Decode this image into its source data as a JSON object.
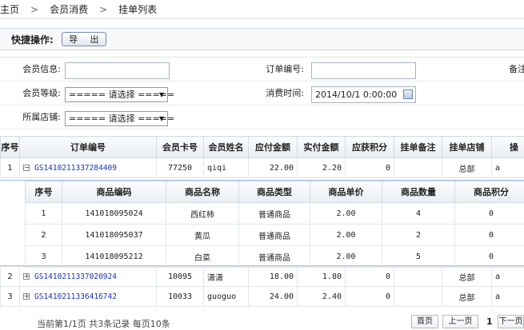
{
  "breadcrumb": {
    "items": [
      "主页",
      "会员消费",
      "挂单列表"
    ],
    "sep": ">"
  },
  "quick": {
    "label": "快捷操作:",
    "export_button": "导 出"
  },
  "form": {
    "member_info_label": "会员信息:",
    "member_info_value": "",
    "order_no_label": "订单编号:",
    "order_no_value": "",
    "remark_label": "备注",
    "member_level_label": "会员等级:",
    "member_level_value": "===== 请选择 =====",
    "consume_time_label": "消费时间:",
    "consume_time_value": "2014/10/1 0:00:00",
    "store_label": "所属店铺:",
    "store_value": "===== 请选择 ====="
  },
  "table": {
    "headers": [
      "序号",
      "订单编号",
      "会员卡号",
      "会员姓名",
      "应付金额",
      "实付金额",
      "应获积分",
      "挂单备注",
      "挂单店铺",
      "操"
    ],
    "rows": [
      {
        "no": "1",
        "order": "GS1410211337284409",
        "card": "77250",
        "name": "qiqi",
        "due": "22.00",
        "paid": "2.20",
        "points": "0",
        "remark": "",
        "store": "总部",
        "op": "a",
        "expander": "−"
      },
      {
        "no": "2",
        "order": "GS1410211337020924",
        "card": "10095",
        "name": "潇潇",
        "due": "18.00",
        "paid": "1.80",
        "points": "0",
        "remark": "",
        "store": "总部",
        "op": "a",
        "expander": "+"
      },
      {
        "no": "3",
        "order": "GS1410211336416742",
        "card": "10033",
        "name": "guoguo",
        "due": "24.00",
        "paid": "2.40",
        "points": "0",
        "remark": "",
        "store": "总部",
        "op": "a",
        "expander": "+"
      }
    ]
  },
  "detail": {
    "headers": [
      "序号",
      "商品编码",
      "商品名称",
      "商品类型",
      "商品单价",
      "商品数量",
      "商品积分"
    ],
    "rows": [
      {
        "no": "1",
        "code": "141018095024",
        "name": "西红柿",
        "type": "普通商品",
        "price": "2.00",
        "qty": "4",
        "points": "0"
      },
      {
        "no": "2",
        "code": "141018095037",
        "name": "黄瓜",
        "type": "普通商品",
        "price": "2.00",
        "qty": "2",
        "points": "0"
      },
      {
        "no": "3",
        "code": "141018095212",
        "name": "白菜",
        "type": "普通商品",
        "price": "2.00",
        "qty": "5",
        "points": "0"
      }
    ]
  },
  "pager": {
    "info": "当前第1/1页 共3条记录 每页10条",
    "first": "首页",
    "prev": "上一页",
    "current": "1",
    "next": "下一页"
  }
}
